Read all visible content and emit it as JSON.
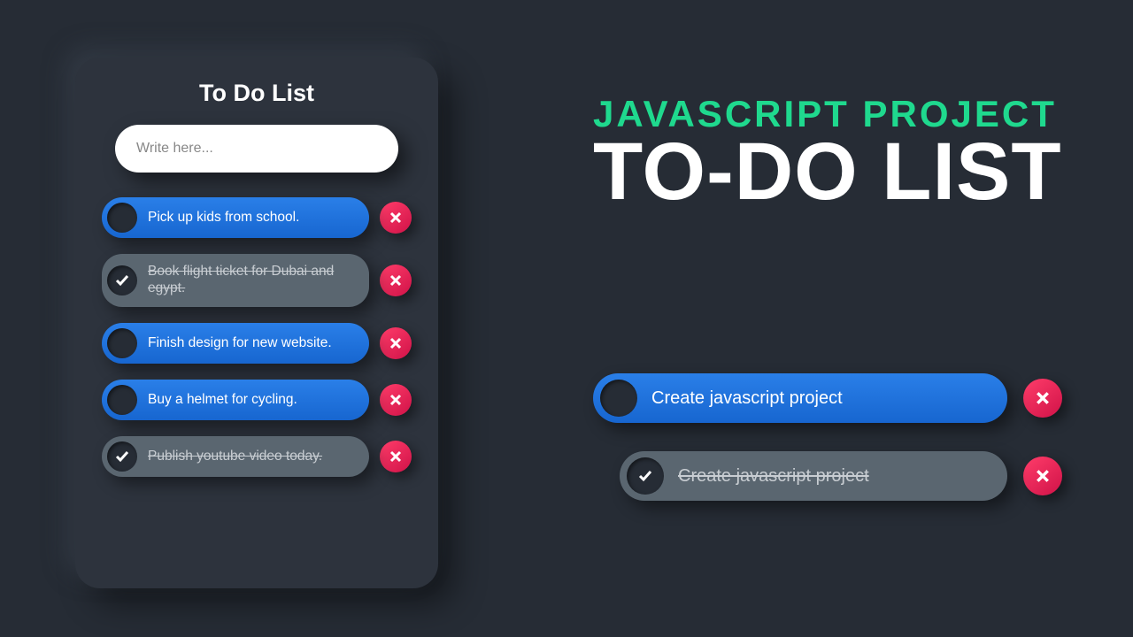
{
  "card": {
    "title": "To Do List",
    "input_placeholder": "Write here...",
    "items": [
      {
        "text": "Pick up kids from school.",
        "done": false
      },
      {
        "text": "Book flight ticket for Dubai and egypt.",
        "done": true
      },
      {
        "text": "Finish design for new website.",
        "done": false
      },
      {
        "text": "Buy a helmet for cycling.",
        "done": false
      },
      {
        "text": "Publish youtube video today.",
        "done": true
      }
    ]
  },
  "headline": {
    "line1": "JAVASCRIPT PROJECT",
    "line2": "TO-DO LIST"
  },
  "samples": [
    {
      "text": "Create javascript project",
      "done": false
    },
    {
      "text": "Create javascript project",
      "done": true
    }
  ]
}
